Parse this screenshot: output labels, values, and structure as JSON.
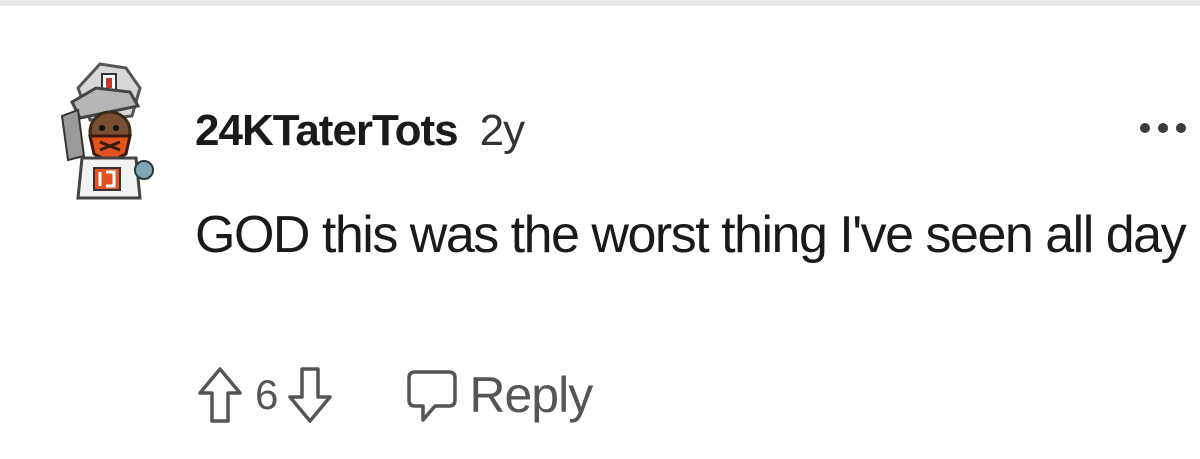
{
  "comment": {
    "username": "24KTaterTots",
    "age": "2y",
    "body": "GOD this was the worst thing I've seen all day",
    "score": "6",
    "reply_label": "Reply"
  },
  "icons": {
    "upvote": "upvote-arrow-icon",
    "downvote": "downvote-arrow-icon",
    "reply": "speech-bubble-icon",
    "more": "more-options-icon",
    "avatar": "user-avatar"
  },
  "colors": {
    "text": "#1a1a1b",
    "muted": "#555555",
    "avatar_accent": "#e2531f"
  }
}
